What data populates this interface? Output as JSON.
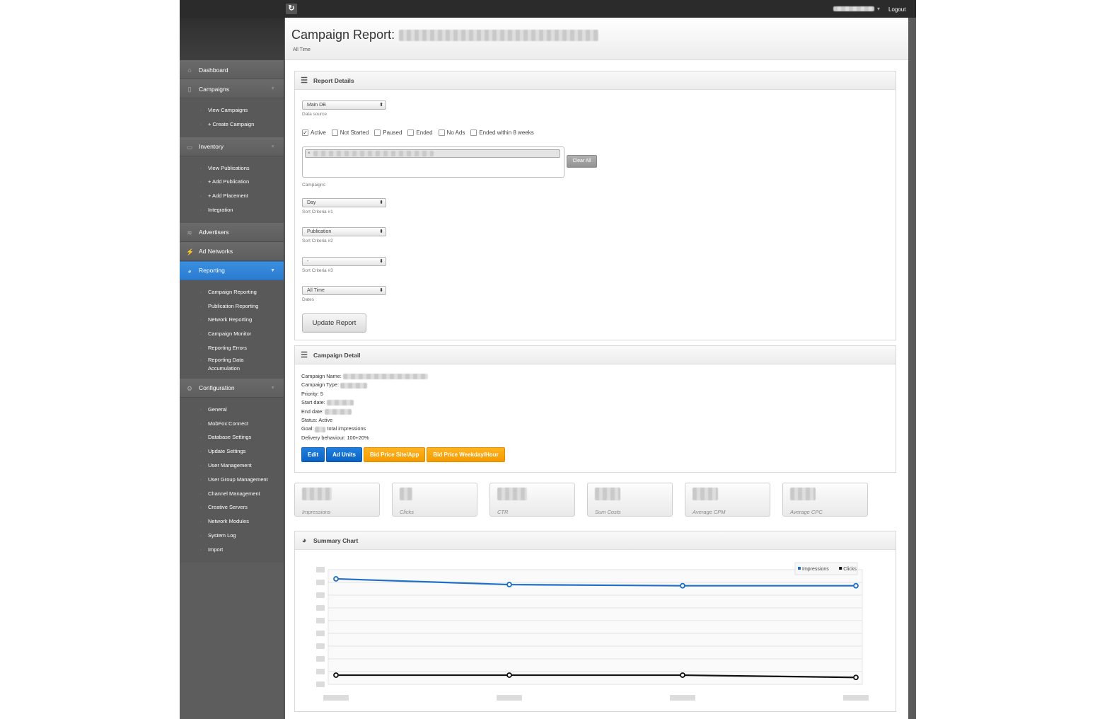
{
  "topbar": {
    "logout": "Logout"
  },
  "sidebar": {
    "sections": [
      {
        "label": "Dashboard",
        "icon": "home-icon"
      },
      {
        "label": "Campaigns",
        "icon": "document-icon",
        "items": [
          "View Campaigns",
          "+ Create Campaign"
        ]
      },
      {
        "label": "Inventory",
        "icon": "clipboard-icon",
        "items": [
          "View Publications",
          "+ Add Publication",
          "+ Add Placement",
          "Integration"
        ]
      },
      {
        "label": "Advertisers",
        "icon": "layers-icon"
      },
      {
        "label": "Ad Networks",
        "icon": "lightning-icon"
      },
      {
        "label": "Reporting",
        "icon": "pie-chart-icon",
        "items": [
          "Campaign Reporting",
          "Publication Reporting",
          "Network Reporting",
          "Campaign Monitor",
          "Reporting Errors",
          "Reporting Data Accumulation"
        ]
      },
      {
        "label": "Configuration",
        "icon": "gear-icon",
        "items": [
          "General",
          "MobFox:Connect",
          "Database Settings",
          "Update Settings",
          "User Management",
          "User Group Management",
          "Channel Management",
          "Creative Servers",
          "Network Modules",
          "System Log",
          "Import"
        ]
      }
    ]
  },
  "page": {
    "title": "Campaign Report:",
    "subtitle": "All Time"
  },
  "report_details": {
    "title": "Report Details",
    "data_source": {
      "value": "Main DB",
      "label": "Data source"
    },
    "statuses": [
      {
        "label": "Active",
        "checked": true
      },
      {
        "label": "Not Started",
        "checked": false
      },
      {
        "label": "Paused",
        "checked": false
      },
      {
        "label": "Ended",
        "checked": false
      },
      {
        "label": "No Ads",
        "checked": false
      },
      {
        "label": "Ended within 8 weeks",
        "checked": false
      }
    ],
    "campaign_tag_remove": "×",
    "clear_all": "Clear All",
    "campaigns_label": "Campaigns",
    "sort1": {
      "value": "Day",
      "label": "Sort Criteria #1"
    },
    "sort2": {
      "value": "Publication",
      "label": "Sort Criteria #2"
    },
    "sort3": {
      "value": "-",
      "label": "Sort Criteria #3"
    },
    "dates": {
      "value": "All Time",
      "label": "Dates"
    },
    "update_button": "Update Report"
  },
  "campaign_detail": {
    "title": "Campaign Detail",
    "name_label": "Campaign Name:",
    "type_label": "Campaign Type:",
    "priority": "Priority: 5",
    "start_label": "Start date:",
    "end_label": "End date:",
    "status": "Status: Active",
    "goal_label": "Goal:",
    "goal_suffix": "total impressions",
    "delivery": "Delivery behaviour: 100+20%",
    "buttons": {
      "edit": "Edit",
      "ad_units": "Ad Units",
      "bid_site": "Bid Price Site/App",
      "bid_weekday": "Bid Price Weekday/Hour"
    }
  },
  "stats": [
    "Impressions",
    "Clicks",
    "CTR",
    "Sum Costs",
    "Average CPM",
    "Average CPC"
  ],
  "summary_chart": {
    "title": "Summary Chart"
  },
  "chart_data": {
    "type": "line",
    "series": [
      {
        "name": "Impressions",
        "color": "#1f6fc5",
        "values": [
          0.92,
          0.87,
          0.86,
          0.86
        ]
      },
      {
        "name": "Clicks",
        "color": "#111111",
        "values": [
          0.08,
          0.08,
          0.08,
          0.06
        ]
      }
    ],
    "legend": "top-right",
    "grid": true
  }
}
